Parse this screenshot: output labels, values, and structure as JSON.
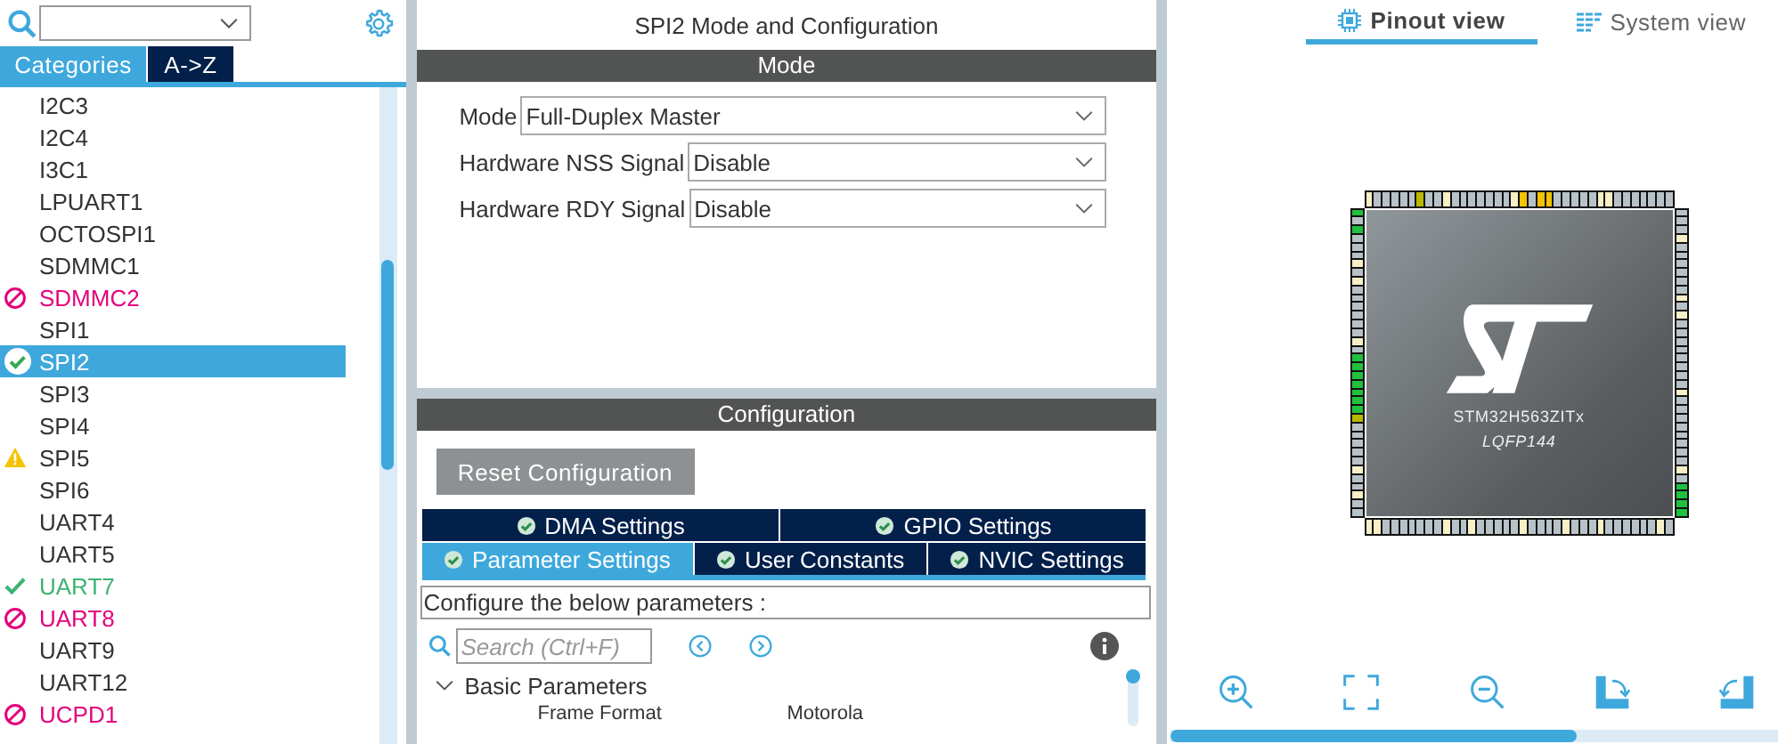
{
  "left_panel": {
    "tabs": [
      {
        "label": "Categories",
        "selected": true
      },
      {
        "label": "A->Z",
        "selected": false
      }
    ],
    "items": [
      {
        "label": "I2C3",
        "kind": "none",
        "selected": false
      },
      {
        "label": "I2C4",
        "kind": "none",
        "selected": false
      },
      {
        "label": "I3C1",
        "kind": "none",
        "selected": false
      },
      {
        "label": "LPUART1",
        "kind": "none",
        "selected": false
      },
      {
        "label": "OCTOSPI1",
        "kind": "none",
        "selected": false
      },
      {
        "label": "SDMMC1",
        "kind": "none",
        "selected": false
      },
      {
        "label": "SDMMC2",
        "kind": "error",
        "selected": false
      },
      {
        "label": "SPI1",
        "kind": "none",
        "selected": false
      },
      {
        "label": "SPI2",
        "kind": "ok",
        "selected": true
      },
      {
        "label": "SPI3",
        "kind": "none",
        "selected": false
      },
      {
        "label": "SPI4",
        "kind": "none",
        "selected": false
      },
      {
        "label": "SPI5",
        "kind": "warning",
        "selected": false
      },
      {
        "label": "SPI6",
        "kind": "none",
        "selected": false
      },
      {
        "label": "UART4",
        "kind": "none",
        "selected": false
      },
      {
        "label": "UART5",
        "kind": "none",
        "selected": false
      },
      {
        "label": "UART7",
        "kind": "configured",
        "selected": false
      },
      {
        "label": "UART8",
        "kind": "error",
        "selected": false
      },
      {
        "label": "UART9",
        "kind": "none",
        "selected": false
      },
      {
        "label": "UART12",
        "kind": "none",
        "selected": false
      },
      {
        "label": "UCPD1",
        "kind": "error",
        "selected": false
      }
    ]
  },
  "center_panel": {
    "title": "SPI2 Mode and Configuration",
    "mode_header": "Mode",
    "mode_fields": [
      {
        "label": "Mode",
        "value": "Full-Duplex Master"
      },
      {
        "label": "Hardware NSS Signal",
        "value": "Disable"
      },
      {
        "label": "Hardware RDY Signal",
        "value": "Disable"
      }
    ],
    "config_header": "Configuration",
    "reset_button": "Reset Configuration",
    "config_tabs": [
      [
        {
          "label": "DMA Settings",
          "selected": false
        },
        {
          "label": "GPIO Settings",
          "selected": false
        }
      ],
      [
        {
          "label": "Parameter Settings",
          "selected": true
        },
        {
          "label": "User Constants",
          "selected": false
        },
        {
          "label": "NVIC Settings",
          "selected": false
        }
      ]
    ],
    "hint": "Configure the below parameters :",
    "search": {
      "placeholder": "Search (Ctrl+F)"
    },
    "group": {
      "label": "Basic Parameters",
      "expanded": true
    },
    "params": [
      {
        "name": "Frame Format",
        "value": "Motorola"
      }
    ]
  },
  "right_panel": {
    "tabs": [
      {
        "label": "Pinout view",
        "selected": true
      },
      {
        "label": "System view",
        "selected": false
      }
    ],
    "chip": {
      "part": "STM32H563ZITx",
      "package": "LQFP144"
    }
  }
}
